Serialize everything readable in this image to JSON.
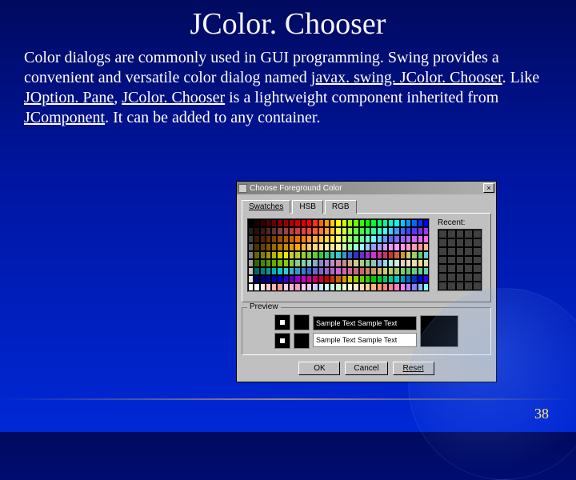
{
  "slide": {
    "title": "JColor. Chooser",
    "body_pre": "Color dialogs are commonly used in GUI programming. Swing provides a convenient and versatile color dialog named ",
    "link1": "javax. swing. JColor. Chooser",
    "body_mid1": ". Like ",
    "link2": "JOption. Pane",
    "body_mid2": ", ",
    "link3": "JColor. Chooser",
    "body_mid3": " is a lightweight component inherited from ",
    "link4": "JComponent",
    "body_post": ". It can be added to any container.",
    "page_number": "38"
  },
  "dialog": {
    "title": "Choose Foreground Color",
    "close_glyph": "×",
    "tabs": {
      "swatches": "Swatches",
      "hsb": "HSB",
      "rgb": "RGB"
    },
    "recent_label": "Recent:",
    "preview_label": "Preview",
    "preview_text1": "Sample Text  Sample Text",
    "preview_text2": "Sample Text  Sample Text",
    "buttons": {
      "ok": "OK",
      "cancel": "Cancel",
      "reset": "Reset"
    }
  },
  "swatch_colors": [
    [
      "#000000",
      "#1a0000",
      "#330000",
      "#4d0000",
      "#660000",
      "#800000",
      "#990000",
      "#b30000",
      "#cc0000",
      "#e60000",
      "#ff0000",
      "#ff3300",
      "#ff6600",
      "#ff9900",
      "#ffcc00",
      "#ffff00",
      "#ccff00",
      "#99ff00",
      "#66ff00",
      "#33ff00",
      "#00ff00",
      "#00ff33",
      "#00ff66",
      "#00ff99",
      "#00ffcc",
      "#00ffff",
      "#00ccff",
      "#0099ff",
      "#0066ff",
      "#0033ff",
      "#0000ff"
    ],
    [
      "#202020",
      "#2a0d0d",
      "#3d1a1a",
      "#502626",
      "#633333",
      "#804040",
      "#a04040",
      "#bf4040",
      "#cc4040",
      "#e64040",
      "#ff4040",
      "#ff5c33",
      "#ff7a33",
      "#ffa333",
      "#ffc933",
      "#ffff40",
      "#ccff40",
      "#99ff40",
      "#66ff40",
      "#40ff40",
      "#33ff66",
      "#33ffa3",
      "#33ffc9",
      "#40ffff",
      "#40ccff",
      "#4099ff",
      "#4066ff",
      "#4040ff",
      "#5c33ff",
      "#7a33ff",
      "#a333ff"
    ],
    [
      "#404040",
      "#3d1a00",
      "#4d2600",
      "#663300",
      "#804000",
      "#994d00",
      "#b35900",
      "#cc6600",
      "#e67300",
      "#ff8000",
      "#ff9933",
      "#ffad33",
      "#ffc233",
      "#ffd633",
      "#ffeb33",
      "#ffff66",
      "#ccff66",
      "#99ff66",
      "#66ff66",
      "#66ff99",
      "#66ffcc",
      "#66ffff",
      "#66ccff",
      "#6699ff",
      "#6666ff",
      "#8066ff",
      "#9966ff",
      "#b366ff",
      "#cc66ff",
      "#e666ff",
      "#ff66ff"
    ],
    [
      "#606060",
      "#4d3300",
      "#664400",
      "#805500",
      "#996600",
      "#b37700",
      "#cc8800",
      "#e69900",
      "#ffaa00",
      "#ffb833",
      "#ffc766",
      "#ffd480",
      "#ffe099",
      "#ffeb99",
      "#fff099",
      "#ffff99",
      "#ccff99",
      "#99ff99",
      "#99ffcc",
      "#99ffff",
      "#99ccff",
      "#9999ff",
      "#b399ff",
      "#cc99ff",
      "#e699ff",
      "#ff99ff",
      "#ff99e6",
      "#ff99cc",
      "#ff99b3",
      "#ff9999",
      "#ffb399"
    ],
    [
      "#808080",
      "#666600",
      "#808000",
      "#999900",
      "#b3b300",
      "#cccc00",
      "#e6e600",
      "#cccc33",
      "#b3cc33",
      "#99cc33",
      "#80cc33",
      "#66cc33",
      "#33cc33",
      "#33cc80",
      "#33ccb3",
      "#33cccc",
      "#3399cc",
      "#3366cc",
      "#3333cc",
      "#6633cc",
      "#9933cc",
      "#cc33cc",
      "#cc3399",
      "#cc3366",
      "#cc3333",
      "#cc6633",
      "#cc9933",
      "#cccc66",
      "#99cc66",
      "#66cc66",
      "#66cccc"
    ],
    [
      "#a0a0a0",
      "#336600",
      "#448800",
      "#559900",
      "#66aa00",
      "#77bb00",
      "#88cc00",
      "#88cc44",
      "#88cc88",
      "#88ccaa",
      "#88cccc",
      "#88aacc",
      "#8888cc",
      "#aa88cc",
      "#cc88cc",
      "#cc88aa",
      "#cc8888",
      "#ccaa88",
      "#cccc88",
      "#aacc88",
      "#88cc88",
      "#88ccaa",
      "#88aaee",
      "#88ddee",
      "#aaeedd",
      "#cceedd",
      "#eecccc",
      "#eeddcc",
      "#eeddaa",
      "#eedd88",
      "#ddddaa"
    ],
    [
      "#c0c0c0",
      "#006666",
      "#008080",
      "#009999",
      "#00b3b3",
      "#00cccc",
      "#33cccc",
      "#33b3cc",
      "#3399cc",
      "#3380cc",
      "#3366cc",
      "#6666cc",
      "#8066cc",
      "#9966cc",
      "#b366cc",
      "#cc66cc",
      "#cc66b3",
      "#cc6699",
      "#cc6680",
      "#cc6666",
      "#cc8066",
      "#cc9966",
      "#ccb366",
      "#cccc66",
      "#b3cc66",
      "#99cc66",
      "#80cc66",
      "#66cc66",
      "#66cc80",
      "#66cc99",
      "#66ccb3"
    ],
    [
      "#e0e0e0",
      "#000066",
      "#000080",
      "#000099",
      "#0000b3",
      "#0000cc",
      "#3300cc",
      "#6600cc",
      "#9900cc",
      "#cc00cc",
      "#cc0099",
      "#cc0066",
      "#cc0033",
      "#cc0000",
      "#cc3300",
      "#cc6600",
      "#cc9900",
      "#cccc00",
      "#99cc00",
      "#66cc00",
      "#33cc00",
      "#00cc00",
      "#00cc33",
      "#00cc66",
      "#00cc99",
      "#00cccc",
      "#0099cc",
      "#0066cc",
      "#0033cc",
      "#0000e6",
      "#3300e6"
    ],
    [
      "#ffffff",
      "#ffffff",
      "#ffe6e6",
      "#ffcccc",
      "#ffb3b3",
      "#ff9999",
      "#ffcce6",
      "#ffb3d9",
      "#ff99cc",
      "#ffccff",
      "#e6ccff",
      "#ccccff",
      "#cce6ff",
      "#ccffff",
      "#ccffe6",
      "#ccffcc",
      "#e6ffcc",
      "#ffffcc",
      "#ffe6cc",
      "#ffd9b3",
      "#ffcc99",
      "#ffb380",
      "#ff9966",
      "#ff8080",
      "#ff8099",
      "#ff80bf",
      "#ff80ff",
      "#bf80ff",
      "#8080ff",
      "#80bfff",
      "#80ffff"
    ]
  ]
}
